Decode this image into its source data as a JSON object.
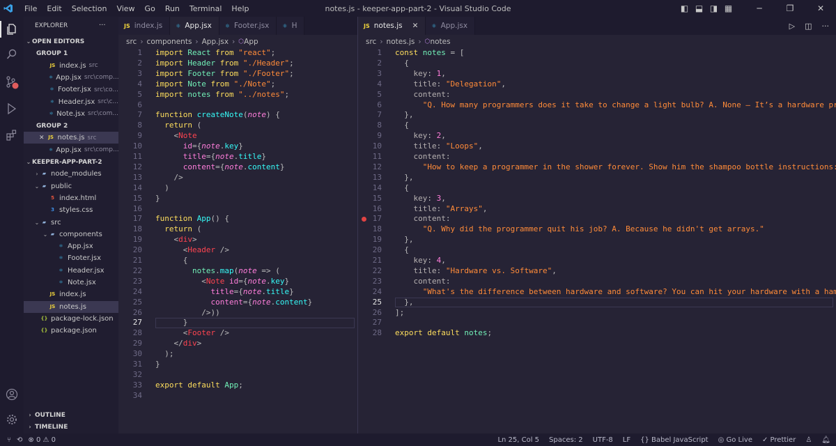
{
  "window": {
    "title": "notes.js - keeper-app-part-2 - Visual Studio Code"
  },
  "menu": [
    "File",
    "Edit",
    "Selection",
    "View",
    "Go",
    "Run",
    "Terminal",
    "Help"
  ],
  "sidebar": {
    "title": "EXPLORER",
    "open_editors": "OPEN EDITORS",
    "group1": "GROUP 1",
    "group2": "GROUP 2",
    "g1_items": [
      {
        "name": "index.js",
        "desc": "src",
        "type": "js"
      },
      {
        "name": "App.jsx",
        "desc": "src\\comp...",
        "type": "jsx"
      },
      {
        "name": "Footer.jsx",
        "desc": "src\\co...",
        "type": "jsx"
      },
      {
        "name": "Header.jsx",
        "desc": "src\\c...",
        "type": "jsx"
      },
      {
        "name": "Note.jsx",
        "desc": "src\\com...",
        "type": "jsx"
      }
    ],
    "g2_items": [
      {
        "name": "notes.js",
        "desc": "src",
        "type": "js",
        "close": "✕"
      },
      {
        "name": "App.jsx",
        "desc": "src\\comp...",
        "type": "jsx"
      }
    ],
    "project": "KEEPER-APP-PART-2",
    "tree": [
      {
        "name": "node_modules",
        "type": "folder",
        "depth": 1,
        "tw": "›"
      },
      {
        "name": "public",
        "type": "folder",
        "depth": 1,
        "tw": "⌄"
      },
      {
        "name": "index.html",
        "type": "html",
        "depth": 2,
        "tw": ""
      },
      {
        "name": "styles.css",
        "type": "css",
        "depth": 2,
        "tw": ""
      },
      {
        "name": "src",
        "type": "folder",
        "depth": 1,
        "tw": "⌄"
      },
      {
        "name": "components",
        "type": "folder",
        "depth": 2,
        "tw": "⌄"
      },
      {
        "name": "App.jsx",
        "type": "jsx",
        "depth": 3,
        "tw": ""
      },
      {
        "name": "Footer.jsx",
        "type": "jsx",
        "depth": 3,
        "tw": ""
      },
      {
        "name": "Header.jsx",
        "type": "jsx",
        "depth": 3,
        "tw": ""
      },
      {
        "name": "Note.jsx",
        "type": "jsx",
        "depth": 3,
        "tw": ""
      },
      {
        "name": "index.js",
        "type": "js",
        "depth": 2,
        "tw": ""
      },
      {
        "name": "notes.js",
        "type": "js",
        "depth": 2,
        "tw": "",
        "selected": true
      },
      {
        "name": "package-lock.json",
        "type": "json",
        "depth": 1,
        "tw": ""
      },
      {
        "name": "package.json",
        "type": "json",
        "depth": 1,
        "tw": ""
      }
    ],
    "outline": "OUTLINE",
    "timeline": "TIMELINE"
  },
  "left_tabs": [
    {
      "name": "index.js",
      "type": "js"
    },
    {
      "name": "App.jsx",
      "type": "jsx",
      "active": true
    },
    {
      "name": "Footer.jsx",
      "type": "jsx"
    },
    {
      "name": "H",
      "type": "jsx"
    }
  ],
  "right_tabs": [
    {
      "name": "notes.js",
      "type": "js",
      "active": true,
      "close": "✕"
    },
    {
      "name": "App.jsx",
      "type": "jsx"
    }
  ],
  "left_crumbs": [
    "src",
    "components",
    "App.jsx",
    "App"
  ],
  "right_crumbs": [
    "src",
    "notes.js",
    "notes"
  ],
  "left_code": [
    [
      [
        "k",
        "import "
      ],
      [
        "t",
        "React "
      ],
      [
        "k",
        "from "
      ],
      [
        "s",
        "\"react\""
      ],
      [
        "p",
        ";"
      ]
    ],
    [
      [
        "k",
        "import "
      ],
      [
        "t",
        "Header "
      ],
      [
        "k",
        "from "
      ],
      [
        "s",
        "\"./Header\""
      ],
      [
        "p",
        ";"
      ]
    ],
    [
      [
        "k",
        "import "
      ],
      [
        "t",
        "Footer "
      ],
      [
        "k",
        "from "
      ],
      [
        "s",
        "\"./Footer\""
      ],
      [
        "p",
        ";"
      ]
    ],
    [
      [
        "k",
        "import "
      ],
      [
        "t",
        "Note "
      ],
      [
        "k",
        "from "
      ],
      [
        "s",
        "\"./Note\""
      ],
      [
        "p",
        ";"
      ]
    ],
    [
      [
        "k",
        "import "
      ],
      [
        "t",
        "notes "
      ],
      [
        "k",
        "from "
      ],
      [
        "s",
        "\"../notes\""
      ],
      [
        "p",
        ";"
      ]
    ],
    [],
    [
      [
        "k",
        "function "
      ],
      [
        "f",
        "createNote"
      ],
      [
        "p",
        "("
      ],
      [
        "it",
        "note"
      ],
      [
        "p",
        ") {"
      ]
    ],
    [
      [
        "p",
        "  "
      ],
      [
        "k",
        "return "
      ],
      [
        "p",
        "("
      ]
    ],
    [
      [
        "p",
        "    <"
      ],
      [
        "tg",
        "Note"
      ]
    ],
    [
      [
        "p",
        "      "
      ],
      [
        "v",
        "id"
      ],
      [
        "p",
        "={"
      ],
      [
        "it",
        "note"
      ],
      [
        "p",
        "."
      ],
      [
        "f",
        "key"
      ],
      [
        "p",
        "}"
      ]
    ],
    [
      [
        "p",
        "      "
      ],
      [
        "v",
        "title"
      ],
      [
        "p",
        "={"
      ],
      [
        "it",
        "note"
      ],
      [
        "p",
        "."
      ],
      [
        "f",
        "title"
      ],
      [
        "p",
        "}"
      ]
    ],
    [
      [
        "p",
        "      "
      ],
      [
        "v",
        "content"
      ],
      [
        "p",
        "={"
      ],
      [
        "it",
        "note"
      ],
      [
        "p",
        "."
      ],
      [
        "f",
        "content"
      ],
      [
        "p",
        "}"
      ]
    ],
    [
      [
        "p",
        "    />"
      ]
    ],
    [
      [
        "p",
        "  )"
      ]
    ],
    [
      [
        "p",
        "}"
      ]
    ],
    [],
    [
      [
        "k",
        "function "
      ],
      [
        "f",
        "App"
      ],
      [
        "p",
        "() {"
      ]
    ],
    [
      [
        "p",
        "  "
      ],
      [
        "k",
        "return "
      ],
      [
        "p",
        "("
      ]
    ],
    [
      [
        "p",
        "    <"
      ],
      [
        "tg",
        "div"
      ],
      [
        "p",
        ">"
      ]
    ],
    [
      [
        "p",
        "      <"
      ],
      [
        "tg",
        "Header "
      ],
      [
        "p",
        "/>"
      ]
    ],
    [
      [
        "p",
        "      {"
      ]
    ],
    [
      [
        "p",
        "        "
      ],
      [
        "t",
        "notes"
      ],
      [
        "p",
        "."
      ],
      [
        "f",
        "map"
      ],
      [
        "p",
        "("
      ],
      [
        "it",
        "note"
      ],
      [
        "p",
        " => ("
      ]
    ],
    [
      [
        "p",
        "          <"
      ],
      [
        "tg",
        "Note "
      ],
      [
        "v",
        "id"
      ],
      [
        "p",
        "={"
      ],
      [
        "it",
        "note"
      ],
      [
        "p",
        "."
      ],
      [
        "f",
        "key"
      ],
      [
        "p",
        "}"
      ]
    ],
    [
      [
        "p",
        "            "
      ],
      [
        "v",
        "title"
      ],
      [
        "p",
        "={"
      ],
      [
        "it",
        "note"
      ],
      [
        "p",
        "."
      ],
      [
        "f",
        "title"
      ],
      [
        "p",
        "}"
      ]
    ],
    [
      [
        "p",
        "            "
      ],
      [
        "v",
        "content"
      ],
      [
        "p",
        "={"
      ],
      [
        "it",
        "note"
      ],
      [
        "p",
        "."
      ],
      [
        "f",
        "content"
      ],
      [
        "p",
        "}"
      ]
    ],
    [
      [
        "p",
        "          />))"
      ]
    ],
    [
      [
        "p",
        "      }"
      ]
    ],
    [
      [
        "p",
        "      <"
      ],
      [
        "tg",
        "Footer "
      ],
      [
        "p",
        "/>"
      ]
    ],
    [
      [
        "p",
        "    </"
      ],
      [
        "tg",
        "div"
      ],
      [
        "p",
        ">"
      ]
    ],
    [
      [
        "p",
        "  );"
      ]
    ],
    [
      [
        "p",
        "}"
      ]
    ],
    [],
    [
      [
        "k",
        "export default "
      ],
      [
        "t",
        "App"
      ],
      [
        "p",
        ";"
      ]
    ],
    []
  ],
  "right_code": [
    [
      [
        "k",
        "const "
      ],
      [
        "t",
        "notes "
      ],
      [
        "p",
        "= ["
      ]
    ],
    [
      [
        "p",
        "  {"
      ]
    ],
    [
      [
        "p",
        "    "
      ],
      [
        "pk",
        "key"
      ],
      [
        "p",
        ": "
      ],
      [
        "v",
        "1"
      ],
      [
        "p",
        ","
      ]
    ],
    [
      [
        "p",
        "    "
      ],
      [
        "pk",
        "title"
      ],
      [
        "p",
        ": "
      ],
      [
        "s",
        "\"Delegation\""
      ],
      [
        "p",
        ","
      ]
    ],
    [
      [
        "p",
        "    "
      ],
      [
        "pk",
        "content"
      ],
      [
        "p",
        ":"
      ]
    ],
    [
      [
        "p",
        "      "
      ],
      [
        "s",
        "\"Q. How many programmers does it take to change a light bulb? A. None – It’s a hardware problem\""
      ]
    ],
    [
      [
        "p",
        "  },"
      ]
    ],
    [
      [
        "p",
        "  {"
      ]
    ],
    [
      [
        "p",
        "    "
      ],
      [
        "pk",
        "key"
      ],
      [
        "p",
        ": "
      ],
      [
        "v",
        "2"
      ],
      [
        "p",
        ","
      ]
    ],
    [
      [
        "p",
        "    "
      ],
      [
        "pk",
        "title"
      ],
      [
        "p",
        ": "
      ],
      [
        "s",
        "\"Loops\""
      ],
      [
        "p",
        ","
      ]
    ],
    [
      [
        "p",
        "    "
      ],
      [
        "pk",
        "content"
      ],
      [
        "p",
        ":"
      ]
    ],
    [
      [
        "p",
        "      "
      ],
      [
        "s",
        "\"How to keep a programmer in the shower forever. Show him the shampoo bottle instructions: Lather. R"
      ]
    ],
    [
      [
        "p",
        "  },"
      ]
    ],
    [
      [
        "p",
        "  {"
      ]
    ],
    [
      [
        "p",
        "    "
      ],
      [
        "pk",
        "key"
      ],
      [
        "p",
        ": "
      ],
      [
        "v",
        "3"
      ],
      [
        "p",
        ","
      ]
    ],
    [
      [
        "p",
        "    "
      ],
      [
        "pk",
        "title"
      ],
      [
        "p",
        ": "
      ],
      [
        "s",
        "\"Arrays\""
      ],
      [
        "p",
        ","
      ]
    ],
    [
      [
        "p",
        "    "
      ],
      [
        "pk",
        "content"
      ],
      [
        "p",
        ":"
      ]
    ],
    [
      [
        "p",
        "      "
      ],
      [
        "s",
        "\"Q. Why did the programmer quit his job? A. Because he didn't get arrays.\""
      ]
    ],
    [
      [
        "p",
        "  },"
      ]
    ],
    [
      [
        "p",
        "  {"
      ]
    ],
    [
      [
        "p",
        "    "
      ],
      [
        "pk",
        "key"
      ],
      [
        "p",
        ": "
      ],
      [
        "v",
        "4"
      ],
      [
        "p",
        ","
      ]
    ],
    [
      [
        "p",
        "    "
      ],
      [
        "pk",
        "title"
      ],
      [
        "p",
        ": "
      ],
      [
        "s",
        "\"Hardware vs. Software\""
      ],
      [
        "p",
        ","
      ]
    ],
    [
      [
        "p",
        "    "
      ],
      [
        "pk",
        "content"
      ],
      [
        "p",
        ":"
      ]
    ],
    [
      [
        "p",
        "      "
      ],
      [
        "s",
        "\"What's the difference between hardware and software? You can hit your hardware with a hammer, but y"
      ]
    ],
    [
      [
        "p",
        "  },"
      ]
    ],
    [
      [
        "p",
        "];"
      ]
    ],
    [],
    [
      [
        "k",
        "export default "
      ],
      [
        "t",
        "notes"
      ],
      [
        "p",
        ";"
      ]
    ]
  ],
  "status": {
    "errors": "⊗ 0 ⚠ 0",
    "position": "Ln 25, Col 5",
    "spaces": "Spaces: 2",
    "encoding": "UTF-8",
    "eol": "LF",
    "language": "{} Babel JavaScript",
    "golive": "Go Live",
    "prettier": "✓ Prettier"
  },
  "colors": {
    "background": "#262335",
    "accent": "#fede5d"
  }
}
